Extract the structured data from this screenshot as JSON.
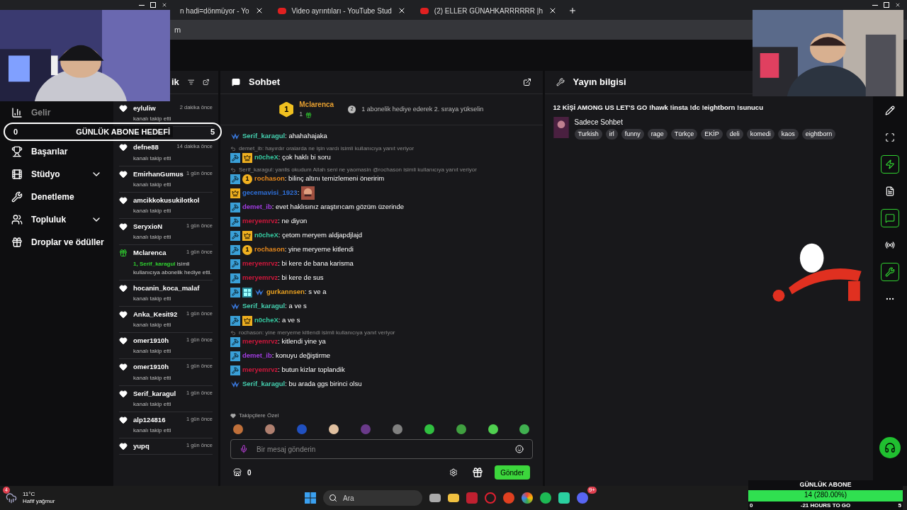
{
  "browser": {
    "tabs": [
      {
        "title": "n hadi=dönmüyor - Yo",
        "selected": false
      },
      {
        "title": "Video ayrıntıları - YouTube Stud",
        "selected": false
      },
      {
        "title": "(2) ELLER GÜNAHKARRRRRR |h",
        "selected": false
      }
    ],
    "address": "m"
  },
  "nav": {
    "items": [
      {
        "label": "Gelir",
        "kind": "link"
      },
      {
        "label": "Başarılar",
        "kind": "link"
      },
      {
        "label": "Stüdyo",
        "kind": "group"
      },
      {
        "label": "Denetleme",
        "kind": "link"
      },
      {
        "label": "Topluluk",
        "kind": "group"
      },
      {
        "label": "Droplar ve ödüller",
        "kind": "link"
      }
    ]
  },
  "activity": {
    "title": "ik",
    "items": [
      {
        "kind": "follow",
        "name": "eyluliw",
        "time": "2 dakika önce",
        "text": "kanalı takip etti"
      },
      {
        "kind": "follow",
        "name": "defne88",
        "time": "14 dakika önce",
        "text": "kanalı takip etti"
      },
      {
        "kind": "follow",
        "name": "EmirhanGumus",
        "time": "1 gün önce",
        "text": "kanalı takip etti"
      },
      {
        "kind": "follow",
        "name": "amcikkokusukilotkol",
        "text": "kanalı takip etti"
      },
      {
        "kind": "follow",
        "name": "SeryxioN",
        "time": "1 gün önce",
        "text": "kanalı takip etti"
      },
      {
        "kind": "gift",
        "name": "Mclarenca",
        "time": "1 gün önce",
        "highlight": "1, Serif_karagul",
        "text": "isimli kullanıcıya abonelik hediye etti."
      },
      {
        "kind": "follow",
        "name": "hocanin_koca_malaf",
        "text": "kanalı takip etti"
      },
      {
        "kind": "follow",
        "name": "Anka_Kesit92",
        "time": "1 gün önce",
        "text": "kanalı takip etti"
      },
      {
        "kind": "follow",
        "name": "omer1910h",
        "time": "1 gün önce",
        "text": "kanalı takip etti"
      },
      {
        "kind": "follow",
        "name": "omer1910h",
        "time": "1 gün önce",
        "text": "kanalı takip etti"
      },
      {
        "kind": "follow",
        "name": "Serif_karagul",
        "time": "1 gün önce",
        "text": "kanalı takip etti"
      },
      {
        "kind": "follow",
        "name": "alp124816",
        "time": "1 gün önce",
        "text": "kanalı takip etti"
      },
      {
        "kind": "follow",
        "name": "yupq",
        "time": "1 gün önce"
      }
    ]
  },
  "chat": {
    "title": "Sohbet",
    "leader": {
      "rank": "1",
      "name": "Mclarenca",
      "count": "1",
      "next_rank": "2",
      "hint": "1 abonelik hediye ederek 2. sıraya yükselin"
    },
    "messages": [
      {
        "badges": [
          {
            "kind": "prime"
          }
        ],
        "user": "Serif_karagul",
        "color": "#45d0b0",
        "text": ": ahahahajaka"
      },
      {
        "reply": "demet_ib: hayırdır oralarda ne işin vardı isimli kullanıcıya yanıt veriyor",
        "badges": [
          {
            "kind": "mod"
          },
          {
            "kind": "crown"
          }
        ],
        "user": "n0cheX",
        "color": "#35c9a0",
        "text": ": çok haklı bi soru"
      },
      {
        "reply": "Serif_karagul: yanlis okudum Allah seni ne yaomasin @rochason isimli kullanıcıya yanıt veriyor",
        "badges": [
          {
            "kind": "mod"
          },
          {
            "kind": "gifter",
            "label": "1"
          }
        ],
        "user": "rochason",
        "color": "#e8891c",
        "text": ": bilinç altını temizlemeni öneririm"
      },
      {
        "badges": [
          {
            "kind": "crown"
          }
        ],
        "user": "gecemavisi_1923",
        "color": "#2e6fd8",
        "text": ":",
        "emote": true
      },
      {
        "badges": [
          {
            "kind": "mod"
          }
        ],
        "user": "demet_ib",
        "color": "#a03ce0",
        "text": ": evet haklısınız araştırıcam gözüm üzerinde"
      },
      {
        "badges": [
          {
            "kind": "mod"
          }
        ],
        "user": "meryemrvz",
        "color": "#d0183c",
        "text": ": ne diyon"
      },
      {
        "badges": [
          {
            "kind": "mod"
          },
          {
            "kind": "crown"
          }
        ],
        "user": "n0cheX",
        "color": "#35c9a0",
        "text": ": çetom meryem aldjapdjlajd"
      },
      {
        "badges": [
          {
            "kind": "mod"
          },
          {
            "kind": "gifter",
            "label": "1"
          }
        ],
        "user": "rochason",
        "color": "#e8891c",
        "text": ": yine meryeme kitlendi"
      },
      {
        "badges": [
          {
            "kind": "mod"
          }
        ],
        "user": "meryemrvz",
        "color": "#d0183c",
        "text": ": bi kere de bana karisma"
      },
      {
        "badges": [
          {
            "kind": "mod"
          }
        ],
        "user": "meryemrvz",
        "color": "#d0183c",
        "text": ": bi kere de sus"
      },
      {
        "badges": [
          {
            "kind": "mod"
          },
          {
            "kind": "gg"
          },
          {
            "kind": "prime"
          }
        ],
        "user": "gurkannsen",
        "color": "#e8a020",
        "text": ": s ve a"
      },
      {
        "badges": [
          {
            "kind": "prime"
          }
        ],
        "user": "Serif_karagul",
        "color": "#45d0b0",
        "text": ": a ve s"
      },
      {
        "badges": [
          {
            "kind": "mod"
          },
          {
            "kind": "crown"
          }
        ],
        "user": "n0cheX",
        "color": "#35c9a0",
        "text": ": a ve s"
      },
      {
        "reply": "rochason: yine meryeme kitlendi isimli kullanıcıya yanıt veriyor",
        "badges": [
          {
            "kind": "mod"
          }
        ],
        "user": "meryemrvz",
        "color": "#d0183c",
        "text": ": kitlendi yine ya"
      },
      {
        "badges": [
          {
            "kind": "mod"
          }
        ],
        "user": "demet_ib",
        "color": "#a03ce0",
        "text": ": konuyu değiştirme"
      },
      {
        "badges": [
          {
            "kind": "mod"
          }
        ],
        "user": "meryemrvz",
        "color": "#d0183c",
        "text": ": butun kizlar toplandik"
      },
      {
        "badges": [
          {
            "kind": "prime"
          }
        ],
        "user": "Serif_karagul",
        "color": "#45d0b0",
        "text": ": bu arada ggs birinci olsu"
      }
    ],
    "emote_section": "Takipçilere Özel",
    "emotes": [
      {
        "color": "#c0703a"
      },
      {
        "color": "#b08070"
      },
      {
        "color": "#2050c0"
      },
      {
        "color": "#e0c0a0"
      },
      {
        "color": "#6a3a8a"
      },
      {
        "color": "#808080"
      },
      {
        "color": "#30c040"
      },
      {
        "color": "#40a040"
      },
      {
        "color": "#50d050"
      },
      {
        "color": "#40b050"
      }
    ],
    "input_placeholder": "Bir mesaj gönderin",
    "points": "0",
    "send": "Gönder"
  },
  "stream_info": {
    "title": "Yayın bilgisi",
    "stream_title": "12 KİŞİ AMONG US LET'S GO !hawk !insta !dc !eightborn !sunucu",
    "category": "Sadece Sohbet",
    "tags": [
      "Turkish",
      "irl",
      "funny",
      "rage",
      "Türkçe",
      "EKİP",
      "deli",
      "komedi",
      "kaos",
      "eightborn"
    ]
  },
  "side_tools": [
    {
      "active": false
    },
    {
      "active": false
    },
    {
      "active": true
    },
    {
      "active": false
    },
    {
      "active": true
    },
    {
      "active": false
    },
    {
      "active": true
    },
    {
      "active": false
    }
  ],
  "goal_overlay": {
    "start": "0",
    "title": "GÜNLÜK ABONE HEDEFİ",
    "end": "5"
  },
  "sub_overlay": {
    "title": "GÜNLÜK ABONE",
    "value": "14 (280.00%)",
    "level": 1,
    "start": "0",
    "remaining": "-21 HOURS TO GO",
    "end": "5"
  },
  "taskbar": {
    "temp": "11°C",
    "weather": "Hafif yağmur",
    "weather_badge": "4",
    "search": "Ara",
    "discord_badge": "9+"
  }
}
